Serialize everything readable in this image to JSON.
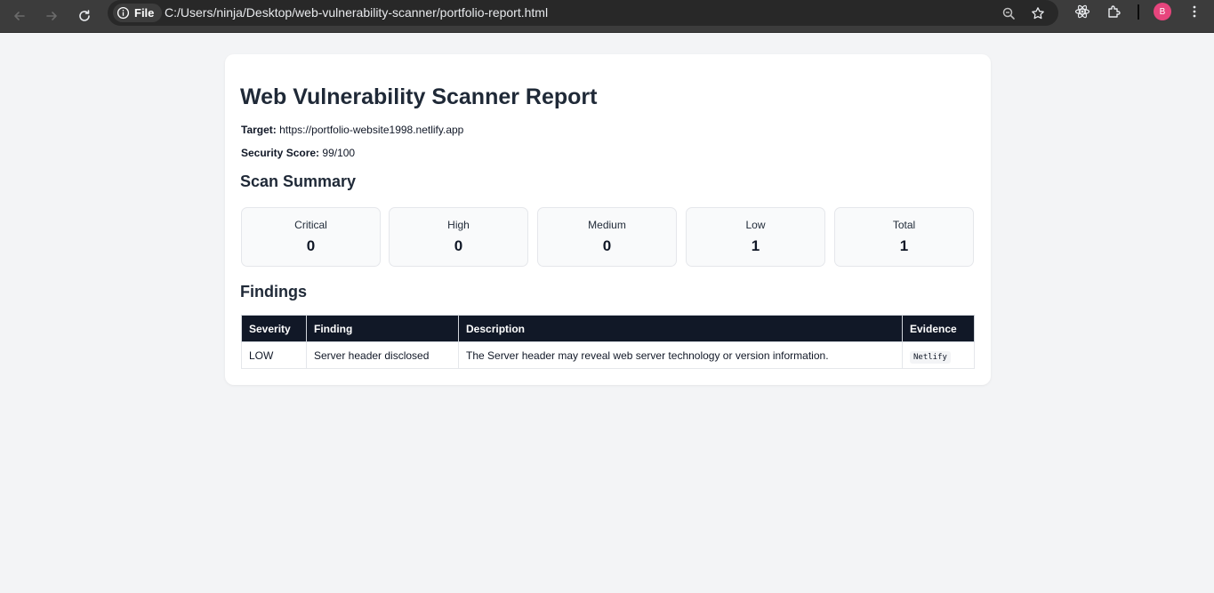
{
  "browser": {
    "url_scheme_label": "File",
    "url": "C:/Users/ninja/Desktop/web-vulnerability-scanner/portfolio-report.html",
    "profile_initial": "B"
  },
  "report": {
    "title": "Web Vulnerability Scanner Report",
    "target_label": "Target:",
    "target_value": "https://portfolio-website1998.netlify.app",
    "score_label": "Security Score:",
    "score_value": "99/100",
    "summary_heading": "Scan Summary",
    "summary": [
      {
        "label": "Critical",
        "value": "0"
      },
      {
        "label": "High",
        "value": "0"
      },
      {
        "label": "Medium",
        "value": "0"
      },
      {
        "label": "Low",
        "value": "1"
      },
      {
        "label": "Total",
        "value": "1"
      }
    ],
    "findings_heading": "Findings",
    "table": {
      "headers": [
        "Severity",
        "Finding",
        "Description",
        "Evidence"
      ],
      "rows": [
        {
          "severity": "LOW",
          "finding": "Server header disclosed",
          "description": "The Server header may reveal web server technology or version information.",
          "evidence": "Netlify"
        }
      ]
    }
  }
}
